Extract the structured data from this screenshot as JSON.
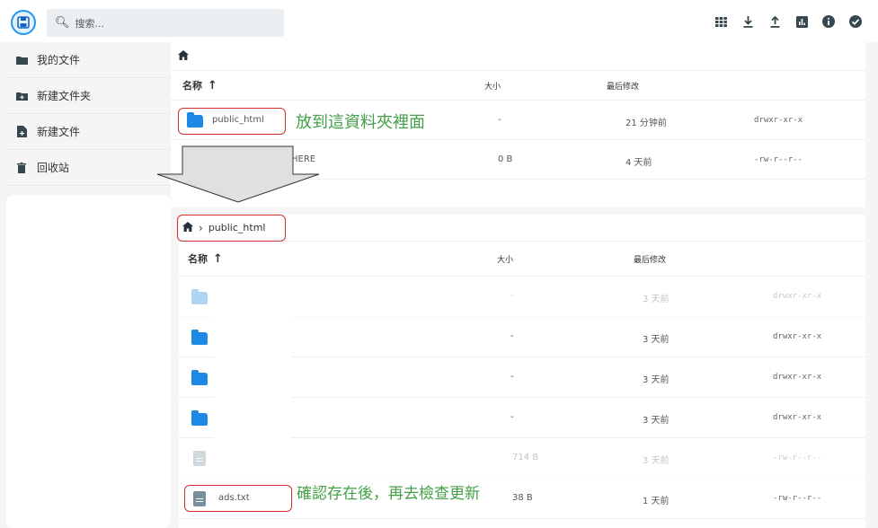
{
  "header": {
    "search_placeholder": "搜索...",
    "icons": [
      "grid-view-icon",
      "download-icon",
      "upload-icon",
      "chart-icon",
      "info-icon",
      "check-icon"
    ]
  },
  "sidebar": {
    "items": [
      {
        "label": "我的文件",
        "icon": "folder-icon"
      },
      {
        "label": "新建文件夹",
        "icon": "new-folder-icon"
      },
      {
        "label": "新建文件",
        "icon": "new-file-icon"
      },
      {
        "label": "回收站",
        "icon": "trash-icon"
      }
    ]
  },
  "top_panel": {
    "columns": {
      "name": "名称",
      "size": "大小",
      "modified": "最后修改"
    },
    "rows": [
      {
        "name": "public_html",
        "size": "-",
        "modified": "21 分钟前",
        "perms": "drwxr-xr-x",
        "type": "folder"
      },
      {
        "name": "HERE",
        "size": "0 B",
        "modified": "4 天前",
        "perms": "-rw-r--r--",
        "type": "file"
      }
    ],
    "annotation": "放到這資料夾裡面"
  },
  "bottom_panel": {
    "breadcrumb": "public_html",
    "columns": {
      "name": "名称",
      "size": "大小",
      "modified": "最后修改"
    },
    "rows": [
      {
        "name": "",
        "size": "-",
        "modified": "3 天前",
        "perms": "drwxr-xr-x",
        "type": "folder",
        "faded": true
      },
      {
        "name": "",
        "size": "-",
        "modified": "3 天前",
        "perms": "drwxr-xr-x",
        "type": "folder",
        "faded": false
      },
      {
        "name": "",
        "size": "-",
        "modified": "3 天前",
        "perms": "drwxr-xr-x",
        "type": "folder",
        "faded": false
      },
      {
        "name": "",
        "size": "-",
        "modified": "3 天前",
        "perms": "drwxr-xr-x",
        "type": "folder",
        "faded": false
      },
      {
        "name": "",
        "size": "714 B",
        "modified": "3 天前",
        "perms": "-rw-r--r--",
        "type": "file",
        "faded": true
      },
      {
        "name": "ads.txt",
        "size": "38 B",
        "modified": "1 天前",
        "perms": "-rw-r--r--",
        "type": "file",
        "faded": false
      }
    ],
    "annotation": "確認存在後，再去檢查更新"
  },
  "colors": {
    "accent": "#1e88e5",
    "annotation": "#43a047",
    "highlight": "#d32f2f"
  }
}
